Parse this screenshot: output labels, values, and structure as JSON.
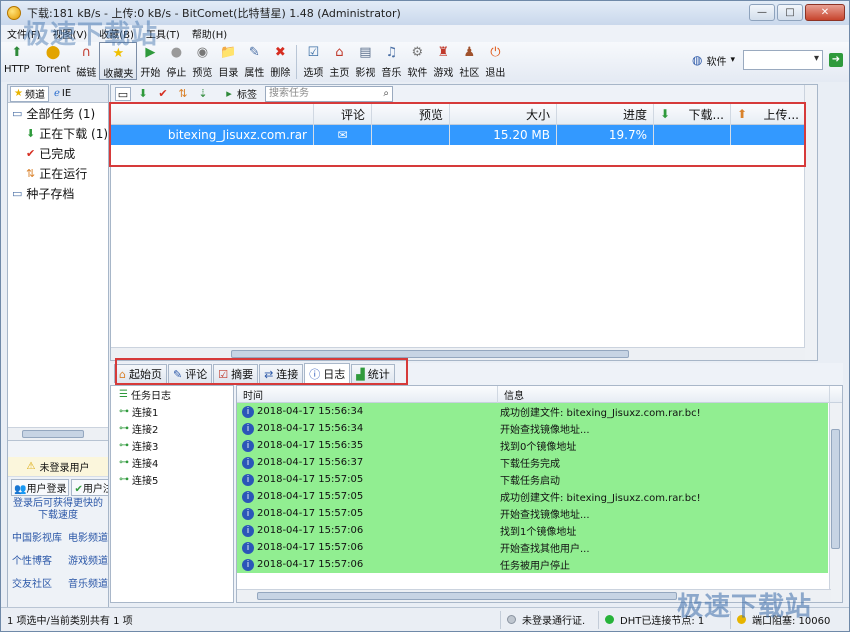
{
  "window": {
    "title": "下载:181 kB/s - 上传:0 kB/s - BitComet(比特彗星) 1.48 (Administrator)",
    "buttons": {
      "min": "—",
      "max": "□",
      "close": "✕"
    }
  },
  "menu": [
    "文件(F)",
    "视图(V)",
    "收藏(B)",
    "工具(T)",
    "帮助(H)"
  ],
  "toolbar": {
    "items": [
      {
        "label": "HTTP",
        "icon": "http-add-icon",
        "glyph": "⬆",
        "color": "#2f8a3a"
      },
      {
        "label": "Torrent",
        "icon": "torrent-icon",
        "glyph": "⬤",
        "color": "#e2a400"
      },
      {
        "label": "磁链",
        "icon": "magnet-icon",
        "glyph": "∩",
        "color": "#c0392b"
      },
      {
        "label": "收藏夹",
        "icon": "favorites-star-icon",
        "glyph": "★",
        "color": "#f0c000",
        "selected": true
      },
      {
        "label": "开始",
        "icon": "start-icon",
        "glyph": "▶",
        "color": "#2f9a3c"
      },
      {
        "label": "停止",
        "icon": "stop-icon",
        "glyph": "●",
        "color": "#9a9a9a"
      },
      {
        "label": "预览",
        "icon": "preview-icon",
        "glyph": "◉",
        "color": "#777"
      },
      {
        "label": "目录",
        "icon": "folder-icon",
        "glyph": "📁",
        "color": "#d99b2a"
      },
      {
        "label": "属性",
        "icon": "properties-icon",
        "glyph": "✎",
        "color": "#4a6fa5"
      },
      {
        "label": "删除",
        "icon": "delete-icon",
        "glyph": "✖",
        "color": "#d62d20"
      },
      {
        "label": "选项",
        "icon": "options-icon",
        "glyph": "☑",
        "color": "#3a6ea5"
      },
      {
        "label": "主页",
        "icon": "home-icon",
        "glyph": "⌂",
        "color": "#c0392b"
      },
      {
        "label": "影视",
        "icon": "film-icon",
        "glyph": "▤",
        "color": "#5b6f8c"
      },
      {
        "label": "音乐",
        "icon": "music-icon",
        "glyph": "♫",
        "color": "#4a6fa5"
      },
      {
        "label": "软件",
        "icon": "software-icon",
        "glyph": "⚙",
        "color": "#777"
      },
      {
        "label": "游戏",
        "icon": "game-icon",
        "glyph": "♜",
        "color": "#c0392b"
      },
      {
        "label": "社区",
        "icon": "community-icon",
        "glyph": "♟",
        "color": "#a0522d"
      },
      {
        "label": "退出",
        "icon": "exit-icon",
        "glyph": "⏻",
        "color": "#e05a1a"
      }
    ],
    "software_label": "软件"
  },
  "left": {
    "tabs": [
      {
        "label": "频道",
        "icon": "star-icon"
      },
      {
        "label": "IE",
        "icon": "ie-icon"
      }
    ],
    "tree": [
      {
        "label": "全部任务 (1)",
        "icon": "all-tasks-icon",
        "glyph": "▭",
        "indent": 4
      },
      {
        "label": "正在下载 (1)",
        "icon": "download-arrow-icon",
        "glyph": "⬇",
        "color": "#2f9a3c",
        "indent": 18
      },
      {
        "label": "已完成",
        "icon": "check-icon",
        "glyph": "✔",
        "color": "#d62d20",
        "indent": 18
      },
      {
        "label": "正在运行",
        "icon": "running-icon",
        "glyph": "⇅",
        "color": "#d9822b",
        "indent": 18
      },
      {
        "label": "种子存档",
        "icon": "seed-archive-icon",
        "glyph": "▭",
        "indent": 4
      }
    ],
    "login_notice": "未登录用户",
    "login_btn": "用户登录",
    "register_btn": "用户注册",
    "login_tip": "登录后可获得更快的下载速度",
    "links": [
      [
        "中国影视库",
        "电影频道"
      ],
      [
        "个性博客",
        "游戏频道"
      ],
      [
        "交友社区",
        "音乐频道"
      ]
    ]
  },
  "tasks": {
    "search_placeholder": "搜索任务",
    "tag_label": "标签",
    "columns": [
      "",
      "评论",
      "预览",
      "大小",
      "进度",
      "下载...",
      "上传..."
    ],
    "rows": [
      {
        "name": "bitexing_Jisuxz.com.rar",
        "size": "15.20 MB",
        "progress": "19.7%"
      }
    ]
  },
  "bottom": {
    "tabs": [
      "起始页",
      "评论",
      "摘要",
      "连接",
      "日志",
      "统计"
    ],
    "active_tab": "日志",
    "tree": [
      "任务日志",
      "连接1",
      "连接2",
      "连接3",
      "连接4",
      "连接5"
    ],
    "log_head": {
      "time": "时间",
      "msg": "信息"
    },
    "log": [
      {
        "time": "2018-04-17 15:56:34",
        "msg": "成功创建文件: bitexing_Jisuxz.com.rar.bc!"
      },
      {
        "time": "2018-04-17 15:56:34",
        "msg": "开始查找镜像地址..."
      },
      {
        "time": "2018-04-17 15:56:35",
        "msg": "找到0个镜像地址"
      },
      {
        "time": "2018-04-17 15:56:37",
        "msg": "下载任务完成"
      },
      {
        "time": "2018-04-17 15:57:05",
        "msg": "下载任务启动"
      },
      {
        "time": "2018-04-17 15:57:05",
        "msg": "成功创建文件: bitexing_Jisuxz.com.rar.bc!"
      },
      {
        "time": "2018-04-17 15:57:05",
        "msg": "开始查找镜像地址..."
      },
      {
        "time": "2018-04-17 15:57:06",
        "msg": "找到1个镜像地址"
      },
      {
        "time": "2018-04-17 15:57:06",
        "msg": "开始查找其他用户..."
      },
      {
        "time": "2018-04-17 15:57:06",
        "msg": "任务被用户停止"
      }
    ]
  },
  "status": {
    "left": "1 项选中/当前类别共有 1 项",
    "login": "未登录通行证.",
    "dht": "DHT已连接节点: 1",
    "port": "端口阻塞: 10060"
  },
  "watermark": {
    "top": "极速下载站",
    "bottom": "极速下载站"
  }
}
